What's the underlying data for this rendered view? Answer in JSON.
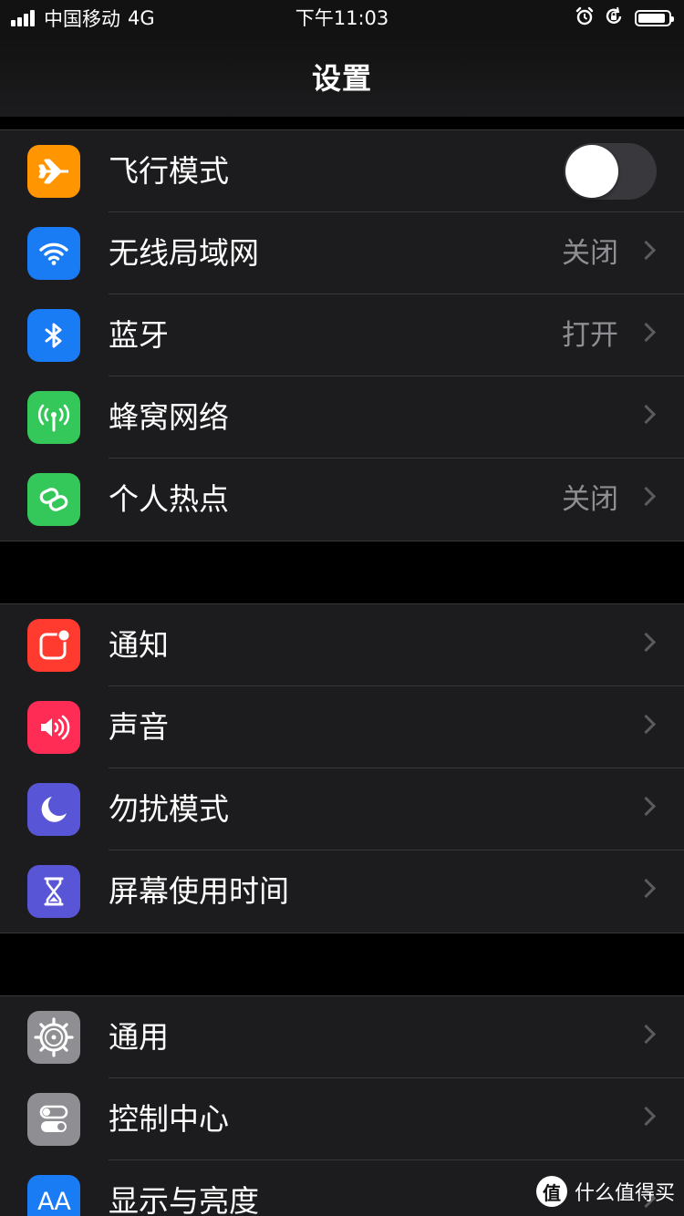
{
  "status_bar": {
    "carrier": "中国移动",
    "network": "4G",
    "time": "下午11:03",
    "icons": [
      "signal-bars-icon",
      "alarm-icon",
      "rotation-lock-icon",
      "battery-icon"
    ],
    "battery_level": 0.9
  },
  "nav": {
    "title": "设置"
  },
  "groups": [
    {
      "items": [
        {
          "label": "飞行模式",
          "icon": "airplane-icon",
          "color": "#ff9500",
          "toggle": false
        },
        {
          "label": "无线局域网",
          "value": "关闭",
          "icon": "wifi-icon",
          "color": "#1a7cf5"
        },
        {
          "label": "蓝牙",
          "value": "打开",
          "icon": "bluetooth-icon",
          "color": "#1a7cf5"
        },
        {
          "label": "蜂窝网络",
          "value": "",
          "icon": "cellular-antenna-icon",
          "color": "#34c759"
        },
        {
          "label": "个人热点",
          "value": "关闭",
          "icon": "hotspot-link-icon",
          "color": "#34c759"
        }
      ]
    },
    {
      "items": [
        {
          "label": "通知",
          "icon": "notification-icon",
          "color": "#ff3b30"
        },
        {
          "label": "声音",
          "icon": "speaker-icon",
          "color": "#ff2d55"
        },
        {
          "label": "勿扰模式",
          "icon": "moon-icon",
          "color": "#5856d6"
        },
        {
          "label": "屏幕使用时间",
          "icon": "hourglass-icon",
          "color": "#5856d6"
        }
      ]
    },
    {
      "items": [
        {
          "label": "通用",
          "icon": "gear-icon",
          "color": "#8e8e93"
        },
        {
          "label": "控制中心",
          "icon": "switches-icon",
          "color": "#8e8e93"
        },
        {
          "label": "显示与亮度",
          "icon": "text-size-icon",
          "color": "#1a7cf5",
          "icon_text": "AA"
        }
      ]
    }
  ],
  "watermark": {
    "logo_char": "值",
    "text": "什么值得买"
  }
}
